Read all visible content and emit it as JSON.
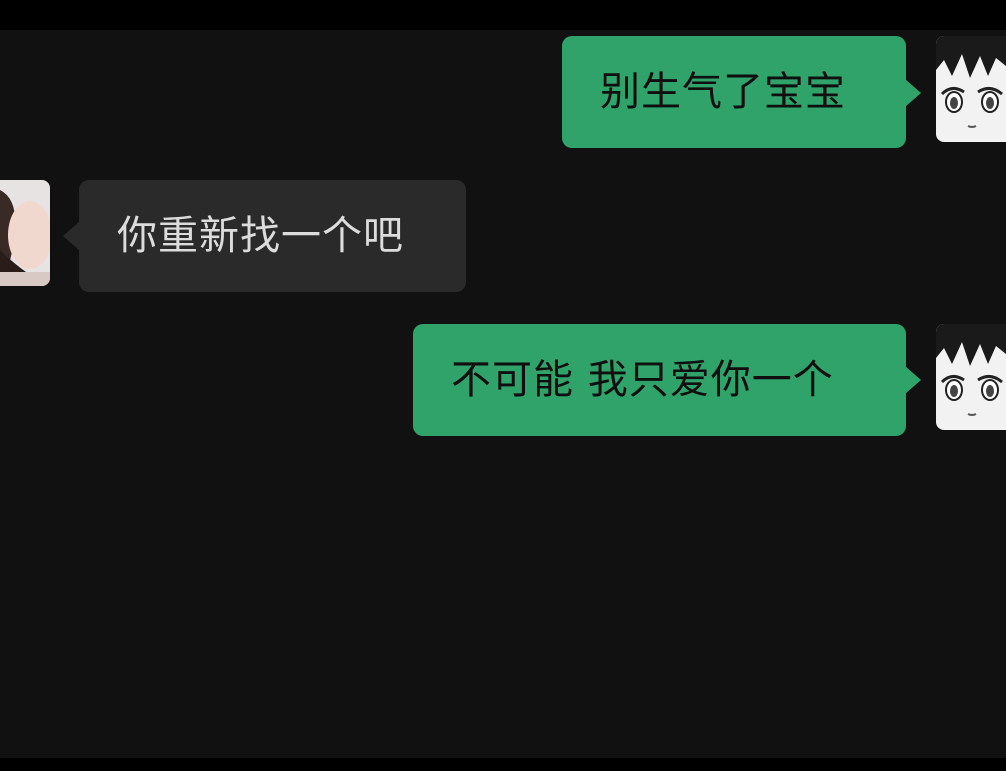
{
  "chat": {
    "messages": [
      {
        "side": "outgoing",
        "text": "别生气了宝宝",
        "avatar_icon": "anime-boy-avatar-icon"
      },
      {
        "side": "incoming",
        "text": "你重新找一个吧",
        "avatar_icon": "girl-avatar-icon"
      },
      {
        "side": "outgoing",
        "text": "不可能 我只爱你一个",
        "avatar_icon": "anime-boy-avatar-icon"
      }
    ]
  },
  "colors": {
    "background": "#111111",
    "outgoing_bubble": "#2fa36a",
    "incoming_bubble": "#2a2a2a"
  }
}
